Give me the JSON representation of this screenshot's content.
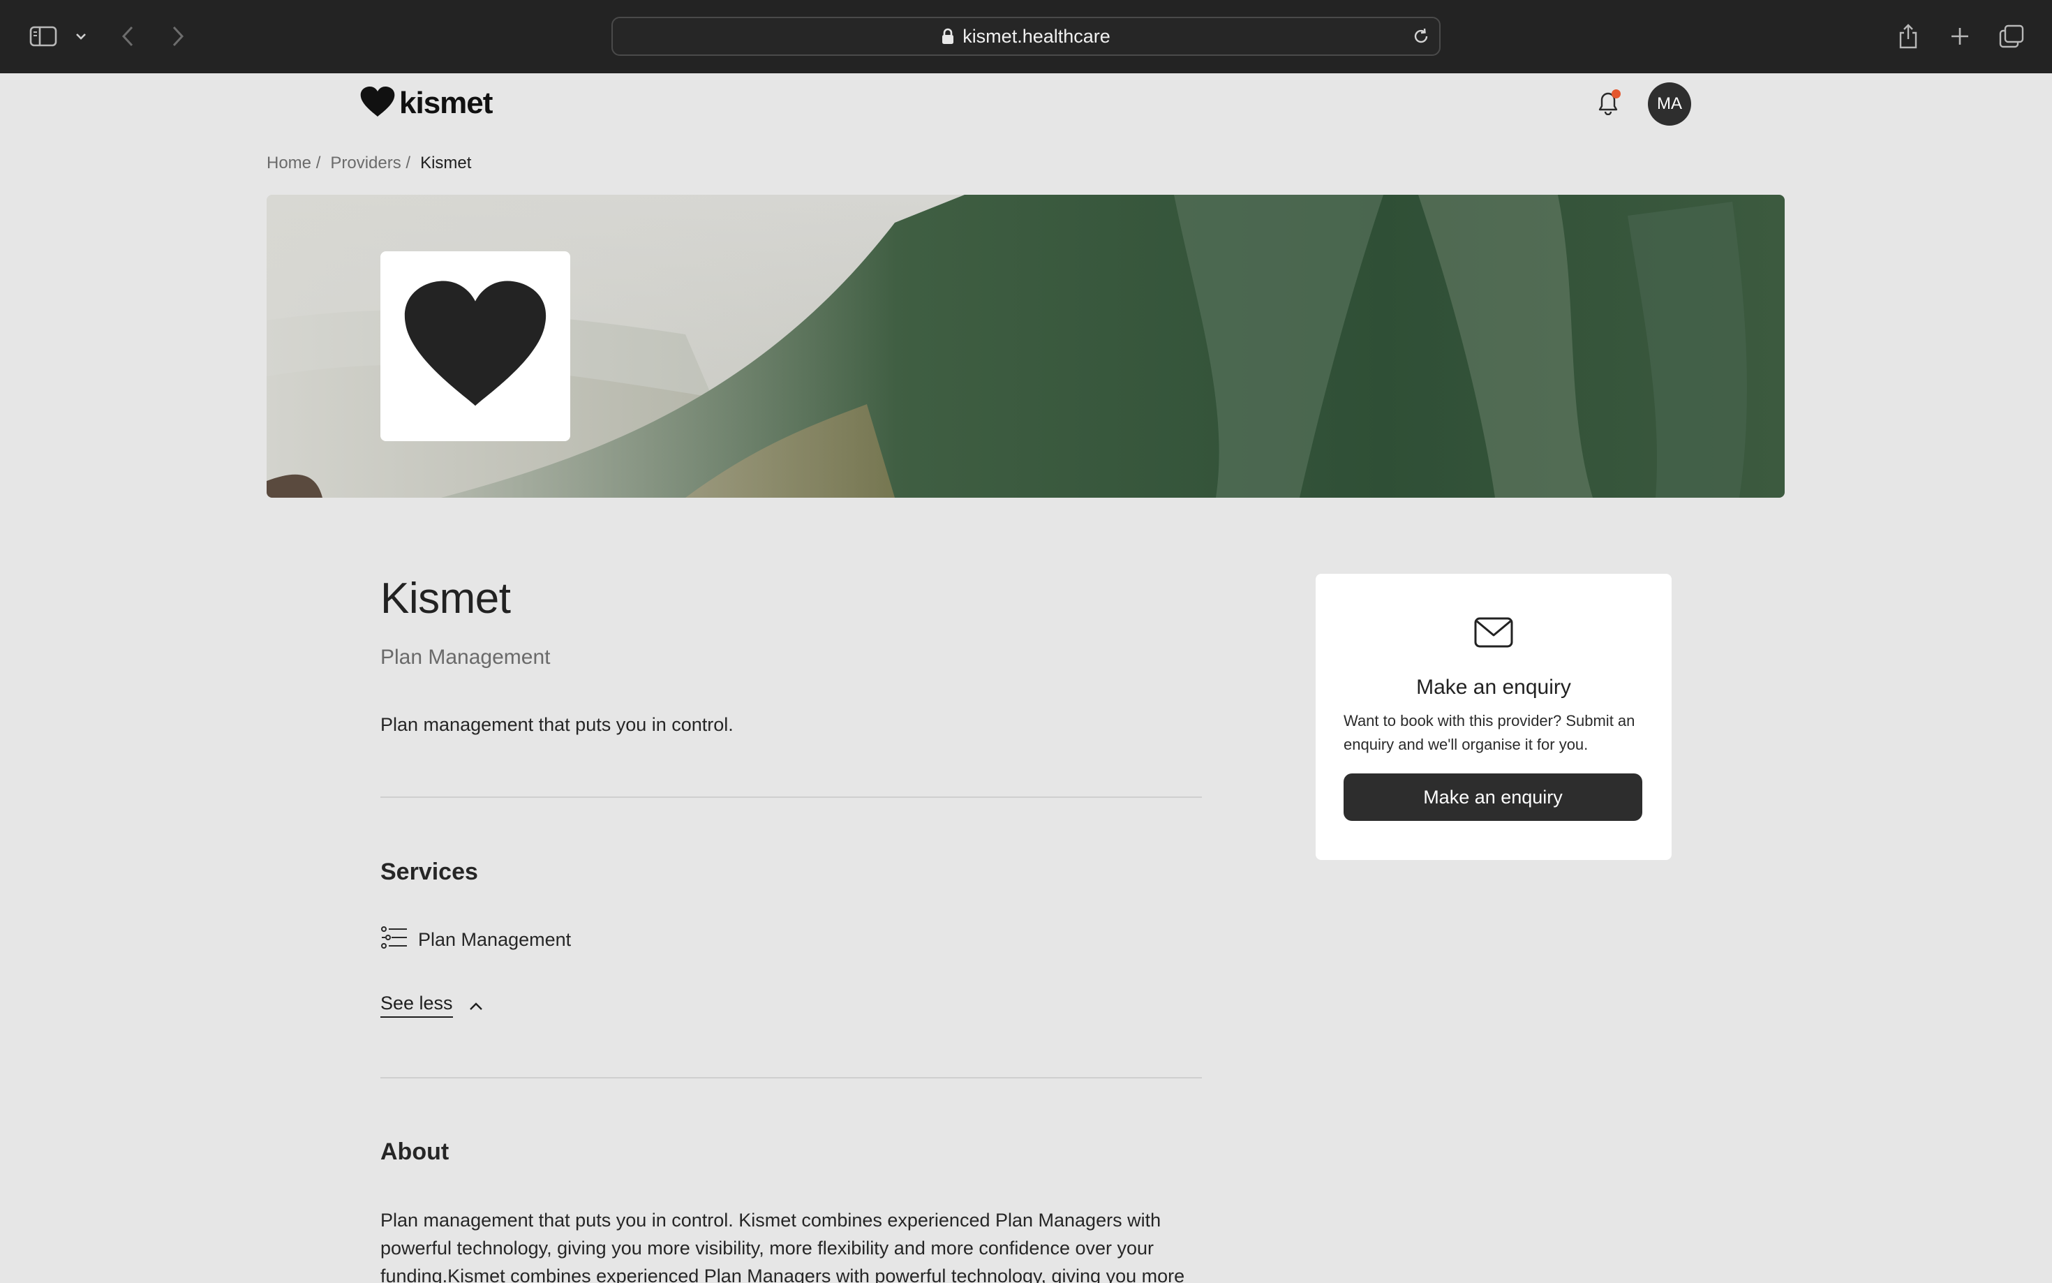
{
  "browser": {
    "url": "kismet.healthcare"
  },
  "header": {
    "logo_text": "kismet",
    "avatar_initials": "MA"
  },
  "breadcrumb": {
    "items": [
      "Home /",
      "Providers /"
    ],
    "current": "Kismet"
  },
  "provider": {
    "name": "Kismet",
    "category": "Plan Management",
    "tagline": "Plan management that puts you in control."
  },
  "services": {
    "heading": "Services",
    "items": [
      {
        "label": "Plan Management",
        "icon": "list-settings-icon"
      }
    ],
    "toggle_label": "See less"
  },
  "about": {
    "heading": "About",
    "text": "Plan management that puts you in control. Kismet combines experienced Plan Managers with powerful technology, giving you more visibility, more flexibility and more confidence over your funding.Kismet combines experienced Plan Managers with powerful technology, giving you more"
  },
  "enquiry": {
    "title": "Make an enquiry",
    "description": "Want to book with this provider? Submit an enquiry and we'll organise it for you.",
    "button_label": "Make an enquiry"
  },
  "colors": {
    "page_background": "#e6e6e6",
    "primary_button": "#2d2d2d",
    "notification_dot": "#e4572e",
    "chrome_background": "#232323"
  }
}
